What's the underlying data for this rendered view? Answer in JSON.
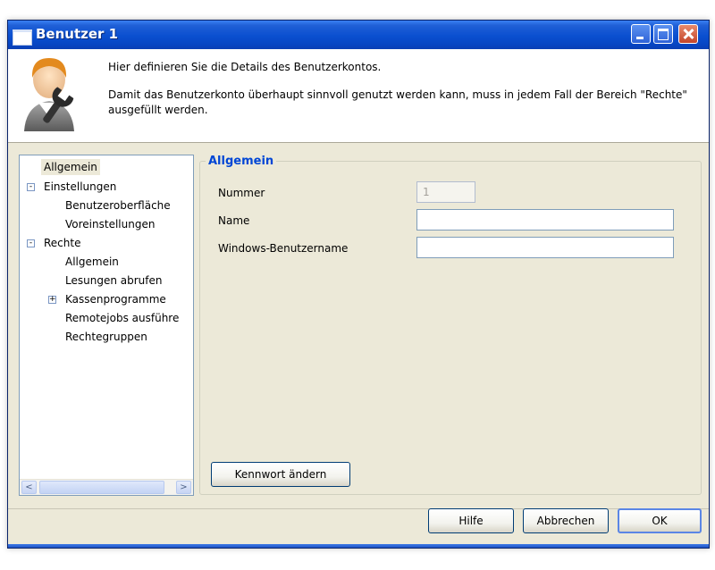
{
  "window": {
    "title": "Benutzer 1"
  },
  "header": {
    "line1": "Hier definieren Sie die Details des Benutzerkontos.",
    "line2": "Damit das Benutzerkonto überhaupt sinnvoll genutzt werden kann, muss in jedem Fall der Bereich \"Rechte\" ausgefüllt werden.",
    "icon": "user-wrench-icon"
  },
  "tree": {
    "items": [
      {
        "label": "Allgemein",
        "selected": true
      },
      {
        "label": "Einstellungen",
        "expander": "-"
      },
      {
        "label": "Benutzeroberfläche"
      },
      {
        "label": "Voreinstellungen"
      },
      {
        "label": "Rechte",
        "expander": "-"
      },
      {
        "label": "Allgemein"
      },
      {
        "label": "Lesungen abrufen"
      },
      {
        "label": "Kassenprogramme",
        "expander": "+"
      },
      {
        "label": "Remotejobs ausführe"
      },
      {
        "label": "Rechtegruppen"
      }
    ],
    "scroll_left": "<",
    "scroll_right": ">"
  },
  "form": {
    "group_title": "Allgemein",
    "nummer_label": "Nummer",
    "nummer_value": "1",
    "name_label": "Name",
    "name_value": "",
    "winuser_label": "Windows-Benutzername",
    "winuser_value": "",
    "change_password_label": "Kennwort ändern"
  },
  "footer": {
    "help_label": "Hilfe",
    "cancel_label": "Abbrechen",
    "ok_label": "OK"
  },
  "colors": {
    "titlebar": "#0a4fd0",
    "group_title": "#0046d5",
    "window_bg": "#ece9d8"
  }
}
